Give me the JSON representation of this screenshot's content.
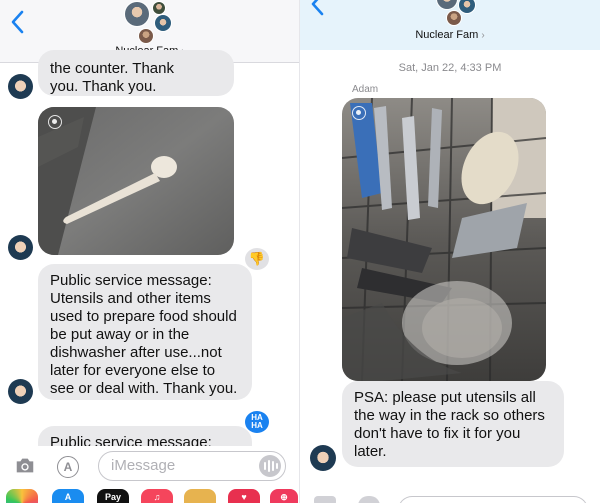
{
  "left": {
    "header": {
      "group_name": "Nuclear Fam",
      "chevron": "›"
    },
    "messages": {
      "m1": "the counter.  Thank\nyou.  Thank you.",
      "m2_photo": "white plastic rice spoon on gray counter",
      "m3": "Public service message: Utensils  and other items used to prepare food should be put away or in the dishwasher after use...not later for everyone else to see or deal with.  Thank you.",
      "m4": "Public service message:"
    },
    "tapbacks": {
      "thumbs_down": "👎",
      "haha": "HA\nHA"
    },
    "composer": {
      "placeholder": "iMessage"
    },
    "apps": [
      "Photos",
      "App Store",
      "Apple Pay",
      "Music",
      "Memoji",
      "Heart",
      "Web"
    ],
    "apay_label": "Pay"
  },
  "right": {
    "header": {
      "group_name": "Nuclear Fam",
      "chevron": "›"
    },
    "timestamp": "Sat, Jan 22, 4:33 PM",
    "sender": "Adam",
    "messages": {
      "photo": "utensils sitting loosely in dishwasher rack",
      "psa": "PSA: please put utensils all the way in the rack so others don't have to fix it for you later."
    }
  },
  "colors": {
    "accent": "#1a82f0",
    "bubble": "#e9e9eb"
  }
}
